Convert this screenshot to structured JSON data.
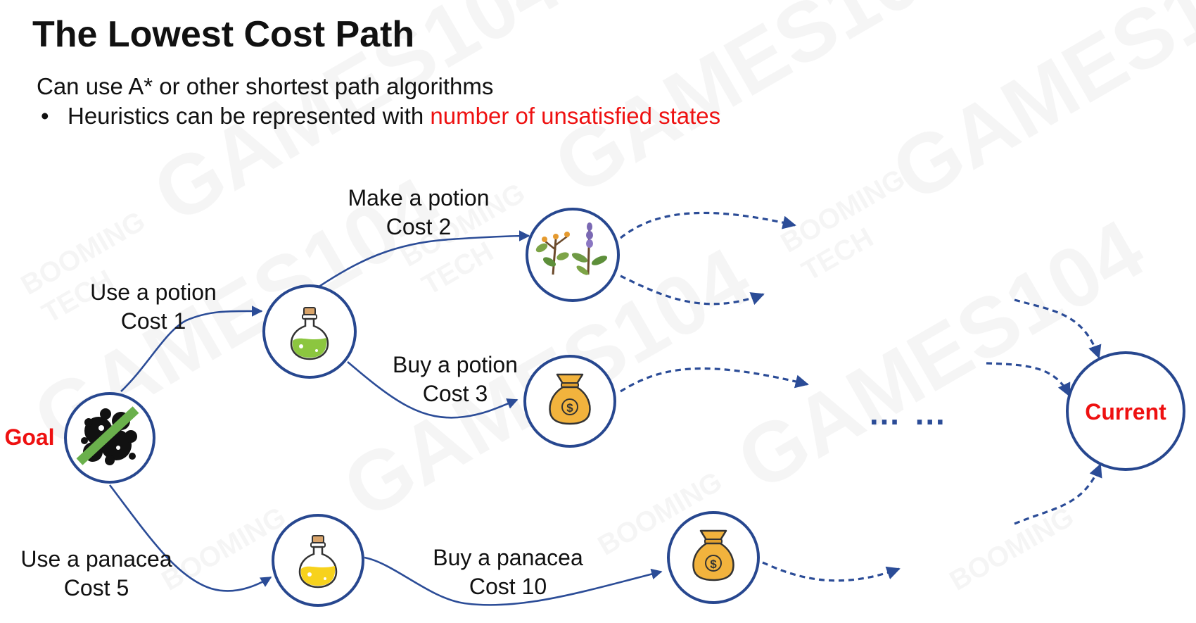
{
  "slide": {
    "title": "The Lowest Cost Path",
    "subtitle": "Can use A* or other shortest path algorithms",
    "bullet_marker": "•",
    "bullet_prefix": "Heuristics can be represented with ",
    "bullet_highlight": "number of unsatisfied states"
  },
  "watermark": {
    "brand": "GAMES104",
    "studio_line1": "BOOMING",
    "studio_line2": "TECH"
  },
  "nodes": {
    "goal": {
      "label": "Goal",
      "icon": "crossed-out-blob-icon"
    },
    "use_potion": {
      "icon": "green-potion-icon"
    },
    "make_potion": {
      "icon": "herbs-icon"
    },
    "buy_potion": {
      "icon": "money-bag-icon"
    },
    "use_panacea": {
      "icon": "yellow-potion-icon"
    },
    "buy_panacea": {
      "icon": "money-bag-icon"
    },
    "current": {
      "label": "Current"
    }
  },
  "edges": {
    "use_potion": {
      "line1": "Use a potion",
      "line2": "Cost 1"
    },
    "make_potion": {
      "line1": "Make a potion",
      "line2": "Cost 2"
    },
    "buy_potion": {
      "line1": "Buy a potion",
      "line2": "Cost 3"
    },
    "use_panacea": {
      "line1": "Use a panacea",
      "line2": "Cost 5"
    },
    "buy_panacea": {
      "line1": "Buy a panacea",
      "line2": "Cost 10"
    }
  },
  "ellipsis": "… …",
  "colors": {
    "accent_red": "#ee1111",
    "edge_blue": "#2b4c97",
    "node_stroke": "#27478f"
  }
}
